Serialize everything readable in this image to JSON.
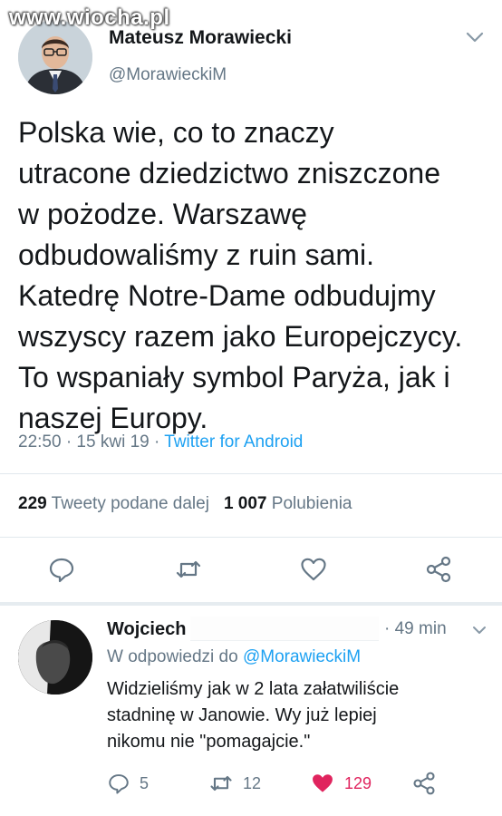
{
  "watermark": "www.wiocha.pl",
  "tweet": {
    "author_name": "Mateusz Morawiecki",
    "author_handle": "@MorawieckiM",
    "text_lines": [
      "Polska wie, co to znaczy",
      "utracone dziedzictwo zniszczone",
      "w pożodze. Warszawę",
      "odbudowaliśmy z ruin sami.",
      "Katedrę Notre-Dame odbudujmy",
      "wszyscy razem jako Europejczycy.",
      "To wspaniały symbol Paryża, jak i",
      "naszej Europy."
    ],
    "timestamp": "22:50 · 15 kwi 19 · ",
    "source": "Twitter for Android",
    "retweets_count": "229",
    "retweets_label": "Tweety podane dalej",
    "likes_count": "1 007",
    "likes_label": "Polubienia",
    "icons": {
      "avatar": "avatar",
      "menu": "chevron-down-icon",
      "reply": "reply-icon",
      "retweet": "retweet-icon",
      "like": "heart-icon",
      "share": "share-icon"
    }
  },
  "reply": {
    "author_name": "Wojciech",
    "time": "· 49 min",
    "reply_prefix": "W odpowiedzi do ",
    "reply_mention": "@MorawieckiM",
    "text_lines": [
      "Widzieliśmy jak w 2 lata załatwiliście",
      "stadninę w Janowie. Wy już lepiej",
      "nikomu nie \"pomagajcie.\""
    ],
    "reply_count": "5",
    "retweet_count": "12",
    "like_count": "129",
    "like_active": true
  },
  "colors": {
    "text": "#14171a",
    "secondary": "#657786",
    "link": "#1da1f2",
    "like_active": "#e0245e",
    "divider": "#e1e8ed"
  }
}
